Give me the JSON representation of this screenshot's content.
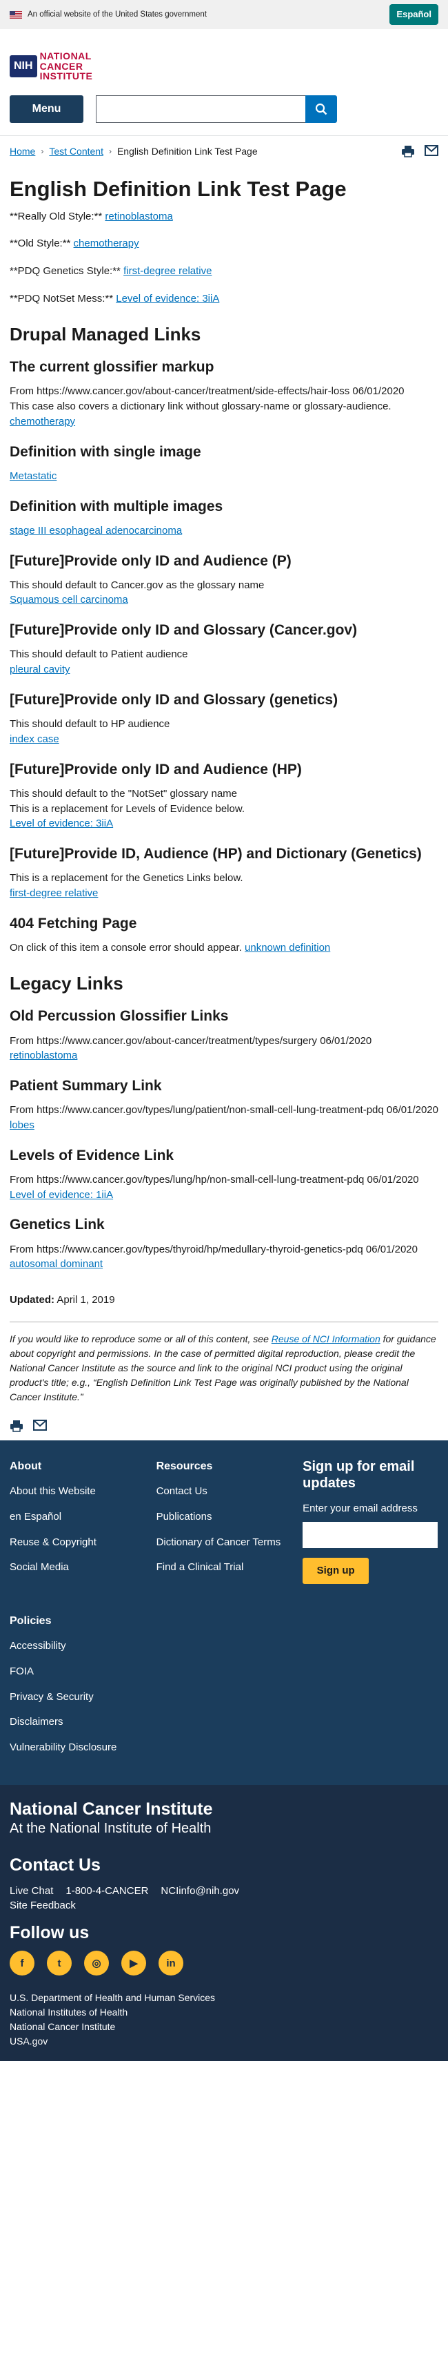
{
  "gov_banner": {
    "text": "An official website of the United States government",
    "espanol": "Español"
  },
  "logo": {
    "nih": "NIH",
    "name": "NATIONAL CANCER INSTITUTE"
  },
  "nav": {
    "menu": "Menu",
    "search_placeholder": ""
  },
  "breadcrumb": {
    "home": "Home",
    "test_content": "Test Content",
    "current": "English Definition Link Test Page"
  },
  "page": {
    "title": "English Definition Link Test Page",
    "styles": [
      {
        "label": "**Really Old Style:**",
        "link": "retinoblastoma"
      },
      {
        "label": "**Old Style:**",
        "link": "chemotherapy"
      },
      {
        "label": "**PDQ Genetics Style:**",
        "link": "first-degree relative"
      },
      {
        "label": "**PDQ NotSet Mess:**",
        "link": "Level of evidence: 3iiA"
      }
    ],
    "drupal_heading": "Drupal Managed Links",
    "s1": {
      "title": "The current glossifier markup",
      "p1": "From https://www.cancer.gov/about-cancer/treatment/side-effects/hair-loss 06/01/2020",
      "p2": "This case also covers a dictionary link without glossary-name or glossary-audience.",
      "link": "chemotherapy"
    },
    "s2": {
      "title": "Definition with single image",
      "link": "Metastatic"
    },
    "s3": {
      "title": "Definition with multiple images",
      "link": "stage III esophageal adenocarcinoma"
    },
    "s4": {
      "title": "[Future]Provide only ID and Audience (P)",
      "p1": "This should default to Cancer.gov as the glossary name",
      "link": "Squamous cell carcinoma"
    },
    "s5": {
      "title": "[Future]Provide only ID and Glossary (Cancer.gov)",
      "p1": "This should default to Patient audience",
      "link": "pleural cavity"
    },
    "s6": {
      "title": "[Future]Provide only ID and Glossary (genetics)",
      "p1": "This should default to HP audience",
      "link": "index case"
    },
    "s7": {
      "title": "[Future]Provide only ID and Audience (HP)",
      "p1": "This should default to the \"NotSet\" glossary name",
      "p2": "This is a replacement for Levels of Evidence below.",
      "link": "Level of evidence: 3iiA"
    },
    "s8": {
      "title": "[Future]Provide ID, Audience (HP) and Dictionary (Genetics)",
      "p1": "This is a replacement for the Genetics Links below.",
      "link": "first-degree relative"
    },
    "s9": {
      "title": "404 Fetching Page",
      "p1": "On click of this item a console error should appear.",
      "link": "unknown definition"
    },
    "legacy_heading": "Legacy Links",
    "l1": {
      "title": "Old Percussion Glossifier Links",
      "p1": "From https://www.cancer.gov/about-cancer/treatment/types/surgery 06/01/2020",
      "link": "retinoblastoma"
    },
    "l2": {
      "title": "Patient Summary Link",
      "p1": "From https://www.cancer.gov/types/lung/patient/non-small-cell-lung-treatment-pdq 06/01/2020",
      "link": "lobes"
    },
    "l3": {
      "title": "Levels of Evidence Link",
      "p1": "From https://www.cancer.gov/types/lung/hp/non-small-cell-lung-treatment-pdq 06/01/2020",
      "link": "Level of evidence: 1iiA"
    },
    "l4": {
      "title": "Genetics Link",
      "p1": "From https://www.cancer.gov/types/thyroid/hp/medullary-thyroid-genetics-pdq 06/01/2020",
      "link": "autosomal dominant"
    },
    "updated_label": "Updated:",
    "updated_date": "April 1, 2019",
    "repro_a": "If you would like to reproduce some or all of this content, see ",
    "repro_link": "Reuse of NCI Information",
    "repro_b": " for guidance about copyright and permissions. In the case of permitted digital reproduction, please credit the National Cancer Institute as the source and link to the original NCI product using the original product's title; e.g., “English Definition Link Test Page was originally published by the National Cancer Institute.”"
  },
  "footer": {
    "about": {
      "heading": "About",
      "items": [
        "About this Website",
        "en Español",
        "Reuse & Copyright",
        "Social Media"
      ]
    },
    "resources": {
      "heading": "Resources",
      "items": [
        "Contact Us",
        "Publications",
        "Dictionary of Cancer Terms",
        "Find a Clinical Trial"
      ]
    },
    "signup": {
      "heading": "Sign up for email updates",
      "label": "Enter your email address",
      "button": "Sign up"
    },
    "policies": {
      "heading": "Policies",
      "items": [
        "Accessibility",
        "FOIA",
        "Privacy & Security",
        "Disclaimers",
        "Vulnerability Disclosure"
      ]
    }
  },
  "footer2": {
    "nci_big": "National Cancer Institute",
    "nci_sub": "At the National Institute of Health",
    "contact_heading": "Contact Us",
    "live_chat": "Live Chat",
    "phone": "1-800-4-CANCER",
    "email": "NCIinfo@nih.gov",
    "site_feedback": "Site Feedback",
    "follow_heading": "Follow us",
    "social": [
      "facebook-icon",
      "twitter-icon",
      "instagram-icon",
      "youtube-icon",
      "linkedin-icon"
    ],
    "agencies": [
      "U.S. Department of Health and Human Services",
      "National Institutes of Health",
      "National Cancer Institute",
      "USA.gov"
    ]
  }
}
